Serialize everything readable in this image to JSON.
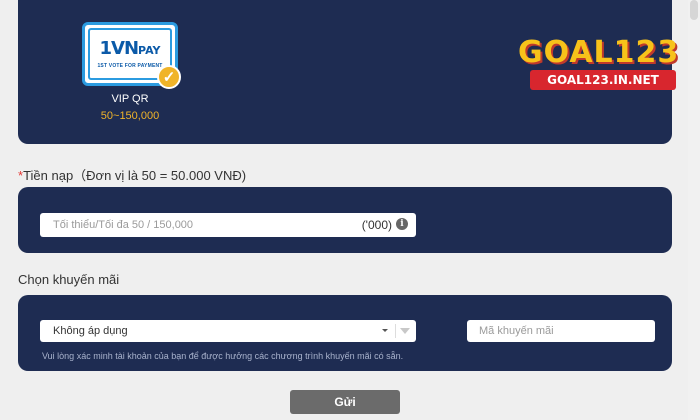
{
  "payment_method": {
    "logo_text": "1VN",
    "logo_pay": "PAY",
    "logo_tagline": "1ST VOTE FOR PAYMENT",
    "name": "VIP QR",
    "range": "50~150,000",
    "icon": "checkmark-icon"
  },
  "brand": {
    "name": "GOAL123",
    "domain": "GOAL123.IN.NET"
  },
  "amount": {
    "required_mark": "*",
    "label": "Tiền nạp（Đơn vị là 50 = 50.000 VNĐ)",
    "placeholder": "Tối thiểu/Tối đa 50 / 150,000",
    "unit": "('000)",
    "info_glyph": "i"
  },
  "promo": {
    "label": "Chọn khuyến mãi",
    "selected": "Không áp dụng",
    "code_placeholder": "Mã khuyến mãi",
    "note": "Vui lòng xác minh tài khoản của bạn để được hưởng các chương trình khuyến mãi có sẵn."
  },
  "submit_label": "Gửi",
  "colors": {
    "panel": "#1e2c52",
    "accent": "#f0b429",
    "button": "#6b6b6b"
  }
}
